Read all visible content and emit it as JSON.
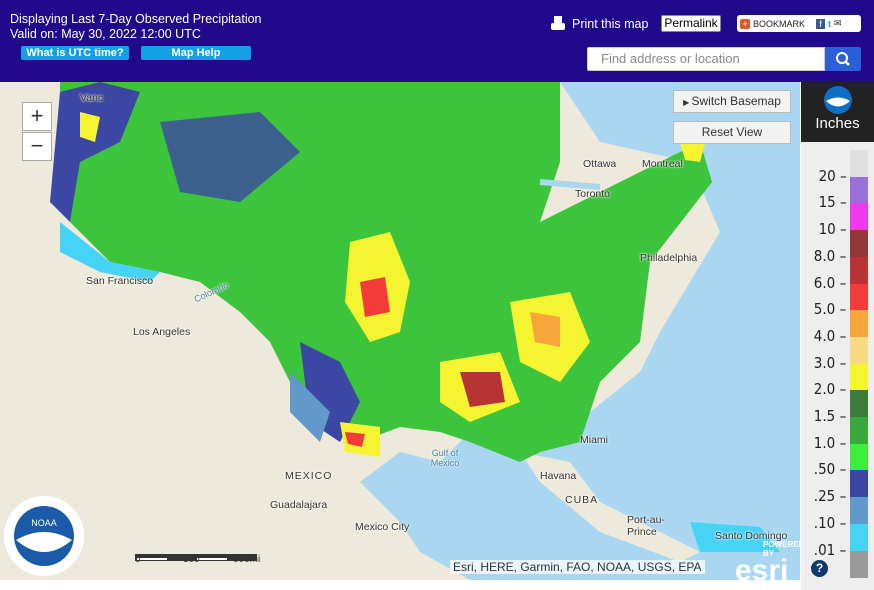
{
  "header": {
    "title_line1": "Displaying Last 7-Day Observed Precipitation",
    "title_line2": "Valid on: May 30, 2022 12:00 UTC",
    "utc_button": "What is UTC time?",
    "help_button": "Map Help",
    "print_label": "Print this map",
    "permalink": "Permalink",
    "bookmark": "BOOKMARK",
    "search_placeholder": "Find address or location"
  },
  "map": {
    "zoom_in": "+",
    "zoom_out": "−",
    "switch_basemap": "Switch Basemap",
    "reset_view": "Reset View",
    "cities": [
      {
        "name": "Vanc"
      },
      {
        "name": "San Francisco"
      },
      {
        "name": "Los Angeles"
      },
      {
        "name": "Ottawa"
      },
      {
        "name": "Montreal"
      },
      {
        "name": "Toronto"
      },
      {
        "name": "Philadelphia"
      },
      {
        "name": "Miami"
      },
      {
        "name": "Havana"
      },
      {
        "name": "CUBA"
      },
      {
        "name": "MEXICO"
      },
      {
        "name": "Guadalajara"
      },
      {
        "name": "Mexico City"
      },
      {
        "name": "Port-au-Prince"
      },
      {
        "name": "Santo Domingo"
      },
      {
        "name": "Gulf of Mexico"
      },
      {
        "name": "Colorado"
      }
    ],
    "scale_labels": [
      "0",
      "300",
      "600mi"
    ],
    "attribution": "Esri, HERE, Garmin, FAO, NOAA, USGS, EPA",
    "powered_by": "POWERED BY",
    "esri": "esri"
  },
  "legend": {
    "unit": "Inches",
    "help": "?",
    "labels": [
      "20",
      "15",
      "10",
      "8.0",
      "6.0",
      "5.0",
      "4.0",
      "3.0",
      "2.0",
      "1.5",
      "1.0",
      ".50",
      ".25",
      ".10",
      ".01"
    ],
    "colors": [
      "#e0e0e0",
      "#9b6fd9",
      "#ee3ae8",
      "#923838",
      "#b83333",
      "#f23c3c",
      "#f6a63a",
      "#f7da85",
      "#f4f431",
      "#3c7d3c",
      "#38aa3c",
      "#3cee3c",
      "#3c47a3",
      "#6299cb",
      "#47d3f5",
      "#9a9a9a"
    ]
  }
}
